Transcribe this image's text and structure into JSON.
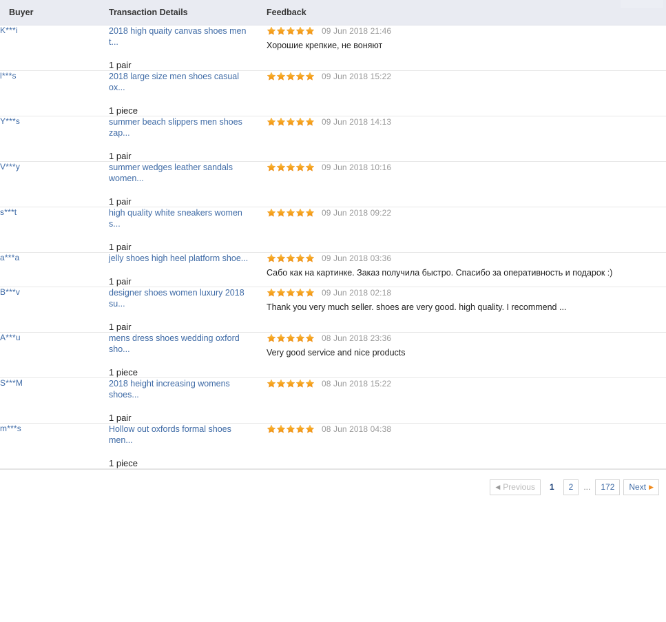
{
  "table": {
    "columns": [
      "Buyer",
      "Transaction Details",
      "Feedback"
    ],
    "rows": [
      {
        "buyer": "K***i",
        "item_title": "2018 high quaity canvas shoes men t...",
        "quantity": "1 pair",
        "rating": 5,
        "date": "09 Jun 2018 21:46",
        "comment": "Хорошие крепкие, не воняют"
      },
      {
        "buyer": "l***s",
        "item_title": "2018 large size men shoes casual ox...",
        "quantity": "1 piece",
        "rating": 5,
        "date": "09 Jun 2018 15:22",
        "comment": ""
      },
      {
        "buyer": "Y***s",
        "item_title": "summer beach slippers men shoes zap...",
        "quantity": "1 pair",
        "rating": 5,
        "date": "09 Jun 2018 14:13",
        "comment": ""
      },
      {
        "buyer": "V***y",
        "item_title": "summer wedges leather sandals women...",
        "quantity": "1 pair",
        "rating": 5,
        "date": "09 Jun 2018 10:16",
        "comment": ""
      },
      {
        "buyer": "s***t",
        "item_title": "high quality white sneakers women s...",
        "quantity": "1 pair",
        "rating": 5,
        "date": "09 Jun 2018 09:22",
        "comment": ""
      },
      {
        "buyer": "a***a",
        "item_title": "jelly shoes high heel platform shoe...",
        "quantity": "1 pair",
        "rating": 5,
        "date": "09 Jun 2018 03:36",
        "comment": "Сабо как на картинке. Заказ получила быстро. Спасибо за оперативность и подарок :)"
      },
      {
        "buyer": "B***v",
        "item_title": "designer shoes women luxury 2018 su...",
        "quantity": "1 pair",
        "rating": 5,
        "date": "09 Jun 2018 02:18",
        "comment": "Thank you very much seller. shoes are very good. high quality. I recommend ..."
      },
      {
        "buyer": "A***u",
        "item_title": "mens dress shoes wedding oxford sho...",
        "quantity": "1 piece",
        "rating": 5,
        "date": "08 Jun 2018 23:36",
        "comment": "Very good service and nice products"
      },
      {
        "buyer": "S***M",
        "item_title": "2018 height increasing womens shoes...",
        "quantity": "1 pair",
        "rating": 5,
        "date": "08 Jun 2018 15:22",
        "comment": ""
      },
      {
        "buyer": "m***s",
        "item_title": "Hollow out oxfords formal shoes men...",
        "quantity": "1 piece",
        "rating": 5,
        "date": "08 Jun 2018 04:38",
        "comment": ""
      }
    ]
  },
  "pagination": {
    "previous_label": "Previous",
    "next_label": "Next",
    "ellipsis": "...",
    "pages": [
      "1",
      "2",
      "172"
    ],
    "current_page": "1"
  },
  "colors": {
    "header_bg": "#e9ebf2",
    "link": "#3f6ba6",
    "star": "#f5a623",
    "date": "#999999",
    "row_border": "#e7e7e7"
  }
}
